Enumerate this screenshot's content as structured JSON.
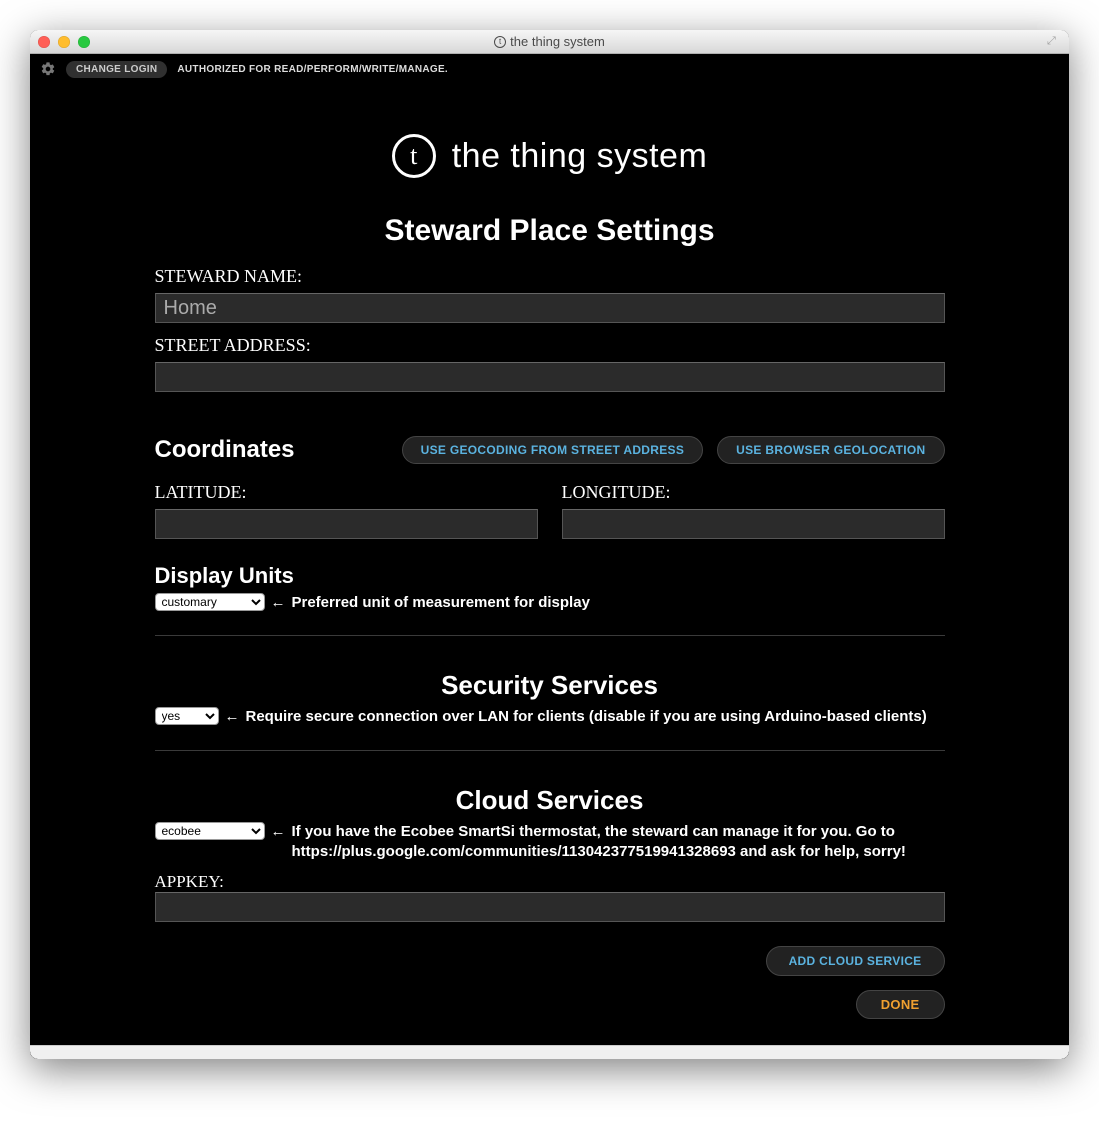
{
  "window": {
    "title": "the thing system",
    "traffic": {
      "close": "close",
      "minimize": "minimize",
      "zoom": "zoom"
    }
  },
  "topbar": {
    "change_login": "CHANGE LOGIN",
    "auth_status": "AUTHORIZED FOR READ/PERFORM/WRITE/MANAGE."
  },
  "brand": {
    "logo_letter": "t",
    "name": "the thing system"
  },
  "page": {
    "title": "Steward Place Settings",
    "steward_name_label": "STEWARD NAME:",
    "steward_name_value": "Home",
    "street_address_label": "STREET ADDRESS:",
    "street_address_value": ""
  },
  "coordinates": {
    "title": "Coordinates",
    "geocode_button": "USE GEOCODING FROM STREET ADDRESS",
    "geolocate_button": "USE BROWSER GEOLOCATION",
    "latitude_label": "LATITUDE:",
    "latitude_value": "",
    "longitude_label": "LONGITUDE:",
    "longitude_value": ""
  },
  "display_units": {
    "title": "Display Units",
    "selected": "customary",
    "help": "Preferred unit of measurement for display"
  },
  "security": {
    "title": "Security Services",
    "selected": "yes",
    "help": "Require secure connection over LAN for clients (disable if you are using Arduino-based clients)"
  },
  "cloud": {
    "title": "Cloud Services",
    "selected": "ecobee",
    "help": "If you have the Ecobee SmartSi thermostat, the steward can manage it for you. Go to https://plus.google.com/communities/113042377519941328693 and ask for help, sorry!",
    "appkey_label": "APPKEY:",
    "appkey_value": "",
    "add_button": "ADD CLOUD SERVICE",
    "done_button": "DONE"
  },
  "arrow": "←"
}
